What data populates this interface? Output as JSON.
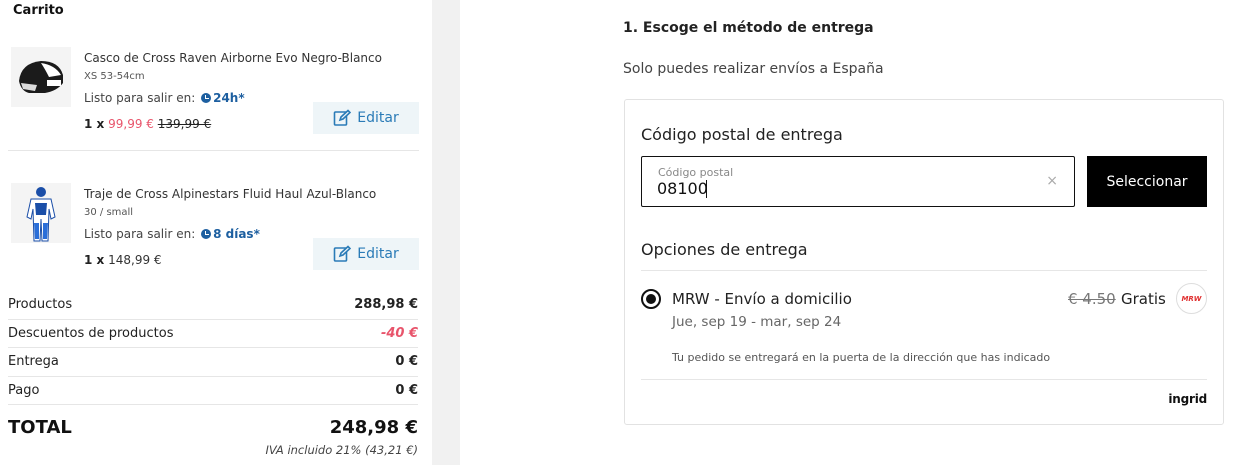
{
  "cart": {
    "title": "Carrito",
    "items": [
      {
        "name": "Casco de Cross Raven Airborne Evo Negro-Blanco",
        "variant": "XS 53-54cm",
        "ready_label": "Listo para salir en:",
        "ready_time": "24h*",
        "qty": "1 x",
        "price": "99,99 €",
        "old_price": "139,99 €",
        "edit_label": "Editar"
      },
      {
        "name": "Traje de Cross Alpinestars Fluid Haul Azul-Blanco",
        "variant": "30 / small",
        "ready_label": "Listo para salir en:",
        "ready_time": "8 días*",
        "qty": "1 x",
        "price": "148,99 €",
        "edit_label": "Editar"
      }
    ]
  },
  "summary": {
    "rows": [
      {
        "label": "Productos",
        "value": "288,98 €"
      },
      {
        "label": "Descuentos de productos",
        "value": "-40 €"
      },
      {
        "label": "Entrega",
        "value": "0 €"
      },
      {
        "label": "Pago",
        "value": "0 €"
      }
    ],
    "total_label": "TOTAL",
    "total_value": "248,98 €",
    "tax_note": "IVA incluido 21% (43,21 €)"
  },
  "delivery": {
    "step_title": "1. Escoge el método de entrega",
    "shipping_note": "Solo puedes realizar envíos a España",
    "postal_title": "Código postal de entrega",
    "postal_label": "Código postal",
    "postal_value": "08100",
    "clear_icon": "×",
    "select_label": "Seleccionar",
    "options_title": "Opciones de entrega",
    "option": {
      "name": "MRW - Envío a domicilio",
      "dates": "Jue, sep 19 - mar, sep 24",
      "old_price": "€ 4.50",
      "price": "Gratis",
      "description": "Tu pedido se entregará en la puerta de la dirección que has indicado",
      "carrier_logo_text": "MRW",
      "selected": true
    },
    "brand": "ingrid"
  },
  "colors": {
    "accent_blue": "#1d5fa0",
    "edit_blue": "#2a7bb7",
    "sale_red": "#e8546b",
    "button_black": "#000000"
  },
  "icons": [
    "helmet-image",
    "suit-image",
    "clock-icon",
    "edit-icon",
    "close-icon",
    "radio-selected-icon",
    "mrw-logo"
  ]
}
